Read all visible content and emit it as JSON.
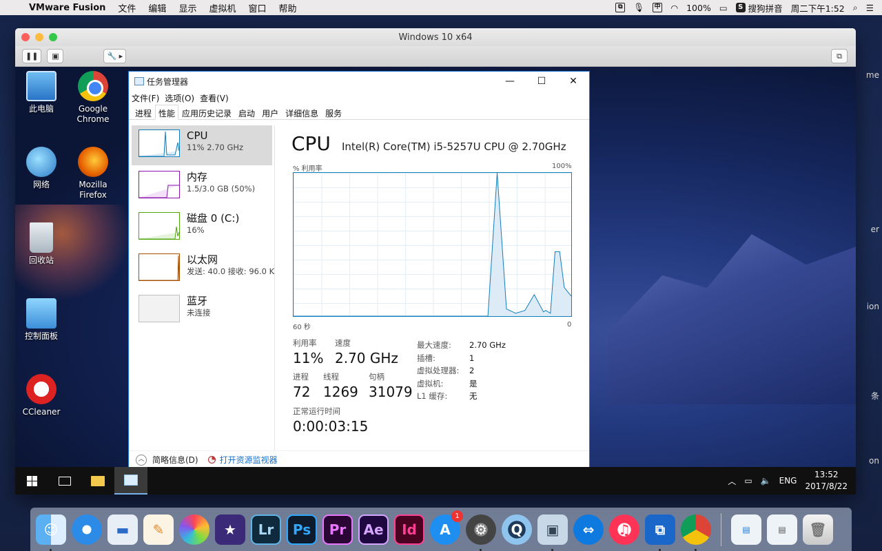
{
  "menubar": {
    "app_name": "VMware Fusion",
    "menus": [
      "文件",
      "编辑",
      "显示",
      "虚拟机",
      "窗口",
      "帮助"
    ],
    "ime_label": "中",
    "battery": "100%",
    "input_method": "搜狗拼音",
    "datetime": "周二下午1:52"
  },
  "vm_window": {
    "title": "Windows 10 x64"
  },
  "mac_side_labels": [
    "me",
    "er",
    "ion",
    "条",
    "on"
  ],
  "desktop_icons": [
    {
      "label": "此电脑"
    },
    {
      "label": "Google Chrome"
    },
    {
      "label": "网络"
    },
    {
      "label": "Mozilla Firefox"
    },
    {
      "label": "回收站"
    },
    {
      "label": "控制面板"
    },
    {
      "label": "CCleaner"
    }
  ],
  "taskmgr": {
    "title": "任务管理器",
    "menu": [
      "文件(F)",
      "选项(O)",
      "查看(V)"
    ],
    "tabs": [
      "进程",
      "性能",
      "应用历史记录",
      "启动",
      "用户",
      "详细信息",
      "服务"
    ],
    "active_tab": "性能",
    "resources": [
      {
        "name": "CPU",
        "value": "11%  2.70 GHz",
        "color": "#117dbb"
      },
      {
        "name": "内存",
        "value": "1.5/3.0 GB (50%)",
        "color": "#8b12ae"
      },
      {
        "name": "磁盘 0 (C:)",
        "value": "16%",
        "color": "#4da60c"
      },
      {
        "name": "以太网",
        "value": "发送: 40.0  接收: 96.0 K",
        "color": "#a74f01"
      },
      {
        "name": "蓝牙",
        "value": "未连接",
        "color": "#c0c0c0"
      }
    ],
    "detail": {
      "heading": "CPU",
      "model": "Intel(R) Core(TM) i5-5257U CPU @ 2.70GHz",
      "y_label": "% 利用率",
      "y_max": "100%",
      "x_left": "60 秒",
      "x_right": "0",
      "stats": {
        "utilization_label": "利用率",
        "utilization": "11%",
        "speed_label": "速度",
        "speed": "2.70 GHz",
        "processes_label": "进程",
        "processes": "72",
        "threads_label": "线程",
        "threads": "1269",
        "handles_label": "句柄",
        "handles": "31079",
        "uptime_label": "正常运行时间",
        "uptime": "0:00:03:15"
      },
      "specs": [
        {
          "key": "最大速度:",
          "value": "2.70 GHz"
        },
        {
          "key": "插槽:",
          "value": "1"
        },
        {
          "key": "虚拟处理器:",
          "value": "2"
        },
        {
          "key": "虚拟机:",
          "value": "是"
        },
        {
          "key": "L1 缓存:",
          "value": "无"
        }
      ]
    },
    "footer": {
      "summary": "简略信息(D)",
      "resource_monitor": "打开资源监视器"
    }
  },
  "chart_data": {
    "type": "area",
    "title": "CPU",
    "ylabel": "% 利用率",
    "xlabel": "",
    "x_range": [
      60,
      0
    ],
    "ylim": [
      0,
      100
    ],
    "x": [
      60,
      55,
      50,
      45,
      42,
      40,
      39,
      38,
      36,
      34,
      32,
      30,
      29,
      28,
      26,
      24,
      22,
      20,
      19,
      18,
      16,
      14,
      12,
      10,
      8,
      6,
      5.5,
      4.5,
      3.5,
      2.5,
      1.5,
      0
    ],
    "values": [
      0,
      0,
      0,
      0,
      0,
      0,
      0,
      0,
      0,
      0,
      0,
      0,
      0,
      0,
      0,
      0,
      0,
      0,
      0,
      0,
      100,
      5,
      2,
      4,
      15,
      3,
      4,
      2,
      45,
      45,
      20,
      14
    ]
  },
  "taskbar": {
    "ime": "ENG",
    "time": "13:52",
    "date": "2017/8/22"
  },
  "dock": {
    "items": [
      "Finder",
      "Safari",
      "Keynote",
      "Pages",
      "Photos",
      "iMovie",
      "Lr",
      "Ps",
      "Pr",
      "Ae",
      "Id",
      "App Store",
      "System Preferences",
      "QuickTime",
      "Preview",
      "TeamViewer",
      "iTunes",
      "VMware Fusion",
      "Chrome"
    ],
    "app_store_badge": "1"
  }
}
